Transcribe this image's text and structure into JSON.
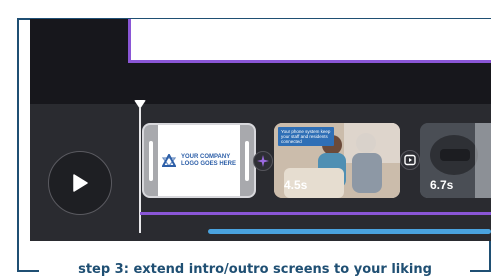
{
  "editor": {
    "clips": [
      {
        "type": "logo",
        "logo_text_line1": "YOUR COMPANY",
        "logo_text_line2": "LOGO GOES HERE"
      },
      {
        "type": "photo",
        "overlay_text": "Your phone system keep your staff and residents connected",
        "duration": "4.5s"
      },
      {
        "type": "photo",
        "duration": "6.7s"
      }
    ],
    "play_icon": "play-icon",
    "transition_icons": [
      "sparkle-icon",
      "transition-icon"
    ]
  },
  "caption": "step 3: extend intro/outro screens to your liking",
  "colors": {
    "accent_purple": "#8a56d6",
    "accent_blue": "#4aa3df",
    "frame_navy": "#1f4f73"
  }
}
